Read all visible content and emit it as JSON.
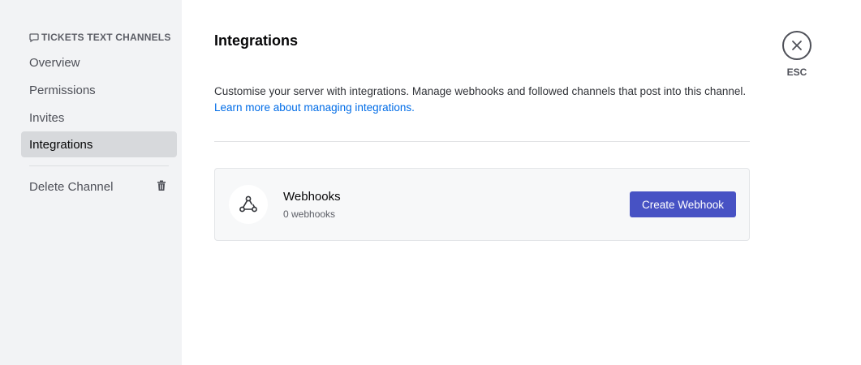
{
  "sidebar": {
    "header": "TICKETS TEXT CHANNELS",
    "items": [
      {
        "label": "Overview"
      },
      {
        "label": "Permissions"
      },
      {
        "label": "Invites"
      },
      {
        "label": "Integrations",
        "active": true
      }
    ],
    "delete_label": "Delete Channel",
    "icons": {
      "header": "chat-bubble-icon",
      "delete": "trash-icon"
    }
  },
  "main": {
    "title": "Integrations",
    "description": "Customise your server with integrations. Manage webhooks and followed channels that post into this channel.",
    "learn_more": "Learn more about managing integrations.",
    "webhooks_card": {
      "title": "Webhooks",
      "subtitle": "0 webhooks",
      "button_label": "Create Webhook",
      "icon": "webhook-icon"
    }
  },
  "close": {
    "label": "ESC",
    "icon": "close-icon"
  },
  "colors": {
    "accent": "#4752c4",
    "link": "#006ce7",
    "sidebar_bg": "#f2f3f5",
    "active_item_bg": "#d7d9dc"
  }
}
